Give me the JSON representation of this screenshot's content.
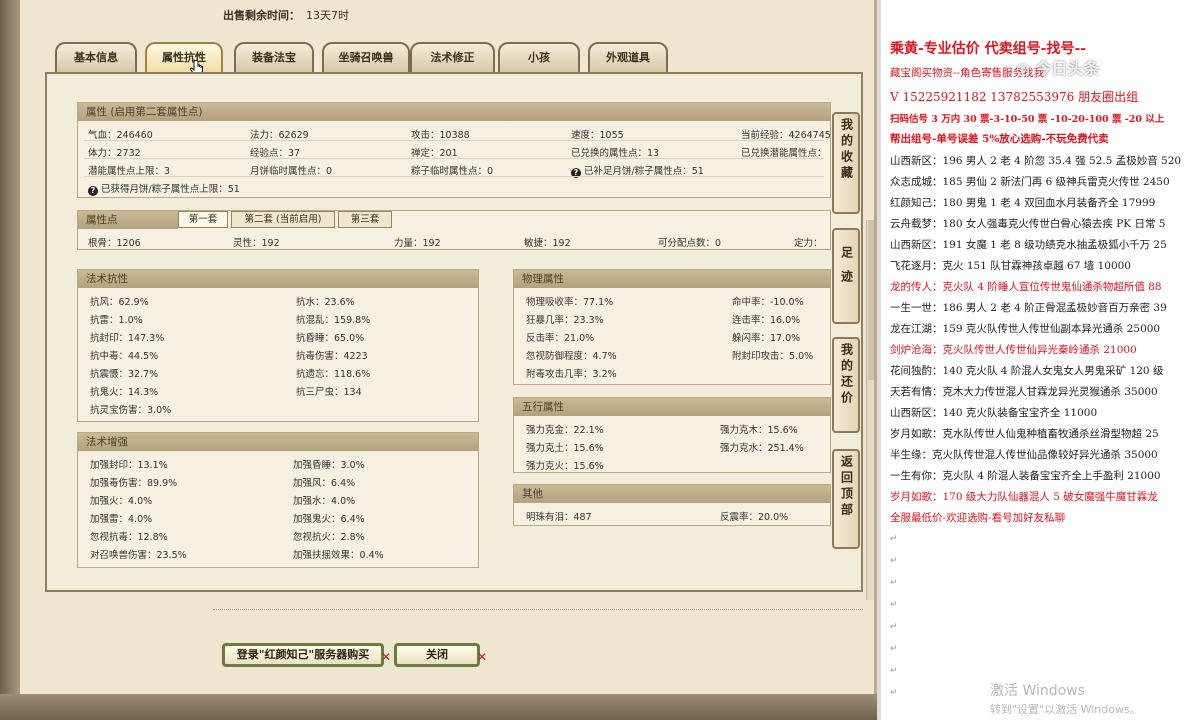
{
  "game": {
    "sale_time_label": "出售剩余时间：",
    "sale_time_value": "13天7时",
    "tabs": [
      "基本信息",
      "属性抗性",
      "装备法宝",
      "坐骑召唤兽",
      "法术修正",
      "小孩",
      "外观道具"
    ],
    "active_tab": "属性抗性",
    "attributes": {
      "title": "属性 (启用第二套属性点)",
      "rows": [
        [
          "气血：246460",
          "法力：62629",
          "攻击：10388",
          "速度：1055",
          "当前经验：4264745"
        ],
        [
          "体力：2732",
          "经验点：37",
          "禅定：201",
          "已兑换的属性点：13",
          "已兑换潜能属性点："
        ],
        [
          "潜能属性点上限：3",
          "月饼临时属性点：0",
          "粽子临时属性点：0",
          "已补足月饼/粽子属性点：51",
          ""
        ]
      ],
      "note": "已获得月饼/粽子属性点上限：51"
    },
    "points": {
      "title": "属性点",
      "subtabs": [
        "第一套",
        "第二套 (当前启用)",
        "第三套"
      ],
      "row": [
        "根骨：1206",
        "灵性：192",
        "力量：192",
        "敏捷：192",
        "可分配点数：0",
        "定力："
      ]
    },
    "magic_resist": {
      "title": "法术抗性",
      "left": [
        "抗风：62.9%",
        "抗雷：1.0%",
        "抗封印：147.3%",
        "抗中毒：44.5%",
        "抗震慑：32.7%",
        "抗鬼火：14.3%",
        "抗灵宝伤害：3.0%"
      ],
      "right": [
        "抗水：23.6%",
        "抗混乱：159.8%",
        "抗昏睡：65.0%",
        "抗毒伤害：4223",
        "抗遗忘：118.6%",
        "抗三尸虫：134",
        ""
      ]
    },
    "magic_boost": {
      "title": "法术增强",
      "left": [
        "加强封印：13.1%",
        "加强毒伤害：89.9%",
        "加强火：4.0%",
        "加强雷：4.0%",
        "忽视抗毒：12.8%",
        "对召唤兽伤害：23.5%"
      ],
      "right": [
        "加强昏睡：3.0%",
        "加强风：6.4%",
        "加强水：4.0%",
        "加强鬼火：6.4%",
        "忽视抗火：2.8%",
        "加强扶摇效果：0.4%"
      ]
    },
    "physical": {
      "title": "物理属性",
      "left": [
        "物理吸收率：77.1%",
        "狂暴几率：23.3%",
        "反击率：21.0%",
        "忽视防御程度：4.7%",
        "附毒攻击几率：3.2%"
      ],
      "right": [
        "命中率：-10.0%",
        "连击率：16.0%",
        "躲闪率：17.0%",
        "附封印攻击：5.0%",
        ""
      ]
    },
    "five_elements": {
      "title": "五行属性",
      "left": [
        "强力克金：22.1%",
        "强力克土：15.6%",
        "强力克火：15.6%"
      ],
      "right": [
        "强力克木：15.6%",
        "强力克水：251.4%",
        ""
      ]
    },
    "other": {
      "title": "其他",
      "left": "明珠有泪：487",
      "right": "反震率：20.0%"
    },
    "buttons": {
      "login_buy": "登录\"红颜知己\"服务器购买",
      "close": "关闭"
    },
    "side_nav": [
      "我的收藏",
      "足迹",
      "我的还价",
      "返回顶部"
    ]
  },
  "doc": {
    "lines": [
      {
        "text": "乘黄-专业估价 代卖组号-找号--",
        "style": "red big"
      },
      {
        "text": "藏宝阁买物资--角色寄售服务找我",
        "style": "red"
      },
      {
        "text": "V 15225921182   13782553976 朋友圈出组",
        "style": "red"
      },
      {
        "text": "扫码估号 3 万内 30 票-3-10-50 票 -10-20-100 票 -20 以上",
        "style": "red bold sm"
      },
      {
        "text": "帮出组号-单号误差 5%放心选购-不玩免费代卖",
        "style": "red bold"
      },
      {
        "text": "山西新区：196 男人 2 老 4 阶忽 35.4 强 52.5 孟极妙音 520",
        "style": ""
      },
      {
        "text": "众志成城：185 男仙 2 新法门再 6 级神兵雷克火传世 2450",
        "style": ""
      },
      {
        "text": "红颜知己：180 男鬼 1 老 4 双回血水月装备齐全 17999",
        "style": ""
      },
      {
        "text": "云舟载梦：180 女人强毒克火传世白骨心猿去疾 PK 日常 5",
        "style": ""
      },
      {
        "text": "山西新区：191 女魔 1 老 8 级功绩克水抽孟极狐小千万 25",
        "style": ""
      },
      {
        "text": "飞花逐月：克火 151 队甘霖神孩卓越 67 墙 10000",
        "style": ""
      },
      {
        "text": "龙的传人：克火队 4 阶睡人宣位传世鬼仙通杀物超所值 88",
        "style": "red"
      },
      {
        "text": "一生一世：186 男人 2 老 4 阶正骨混孟极妙音百万亲密 39",
        "style": ""
      },
      {
        "text": "龙在江湖：159 克火队传世人传世仙副本异光通杀 25000",
        "style": ""
      },
      {
        "text": "剑炉沧海：克火队传世人传世仙异光秦岭通杀 21000",
        "style": "red"
      },
      {
        "text": "花间独酌：140 克火队 4 阶混人女鬼女人男鬼采矿 120 级",
        "style": ""
      },
      {
        "text": "天若有情：克木大力传世混人甘霖龙异光灵猴通杀 35000",
        "style": ""
      },
      {
        "text": "山西新区：140 克火队装备宝宝齐全 11000",
        "style": ""
      },
      {
        "text": "岁月如歌：克水队传世人仙鬼种植畜牧通杀丝滑型物超 25",
        "style": ""
      },
      {
        "text": "半生缘：克火队传世混人传世仙品像较好异光通杀 35000",
        "style": ""
      },
      {
        "text": "一生有你：克火队 4 阶混人装备宝宝齐全上手盈利 21000",
        "style": ""
      },
      {
        "text": "岁月如歌：170 级大力队仙器混人 5 破女魔强牛魔甘霖龙",
        "style": "red"
      },
      {
        "text": "全服最低价-欢迎选购-看号加好友私聊",
        "style": "red"
      }
    ],
    "empty_mark": "↵",
    "watermark": "◎ 今日头条",
    "activation_title": "激活 Windows",
    "activation_sub": "转到\"设置\"以激活 Windows。"
  }
}
